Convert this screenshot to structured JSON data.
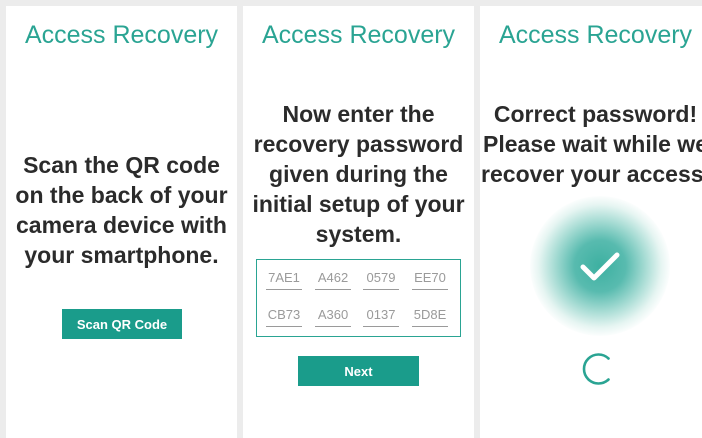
{
  "screens": [
    {
      "title": "Access Recovery",
      "message": [
        "Scan the QR code",
        "on the back of your",
        "camera device with",
        "your smartphone."
      ],
      "button_label": "Scan QR Code"
    },
    {
      "title": "Access Recovery",
      "message": [
        "Now enter the",
        "recovery password",
        "given during the",
        "initial setup of your",
        "system."
      ],
      "password_codes": [
        [
          "7AE1",
          "A462",
          "0579",
          "EE70"
        ],
        [
          "CB73",
          "A360",
          "0137",
          "5D8E"
        ]
      ],
      "button_label": "Next"
    },
    {
      "title": "Access Recovery",
      "message": [
        "Correct password!",
        "Please wait while we",
        "recover your access."
      ]
    }
  ],
  "colors": {
    "accent": "#2aa493",
    "button": "#1a9c8b",
    "text": "#2b2b2b",
    "code_text": "#9a9a9a",
    "background": "#ececec"
  },
  "icons": [
    "checkmark-icon",
    "loading-spinner-icon"
  ]
}
